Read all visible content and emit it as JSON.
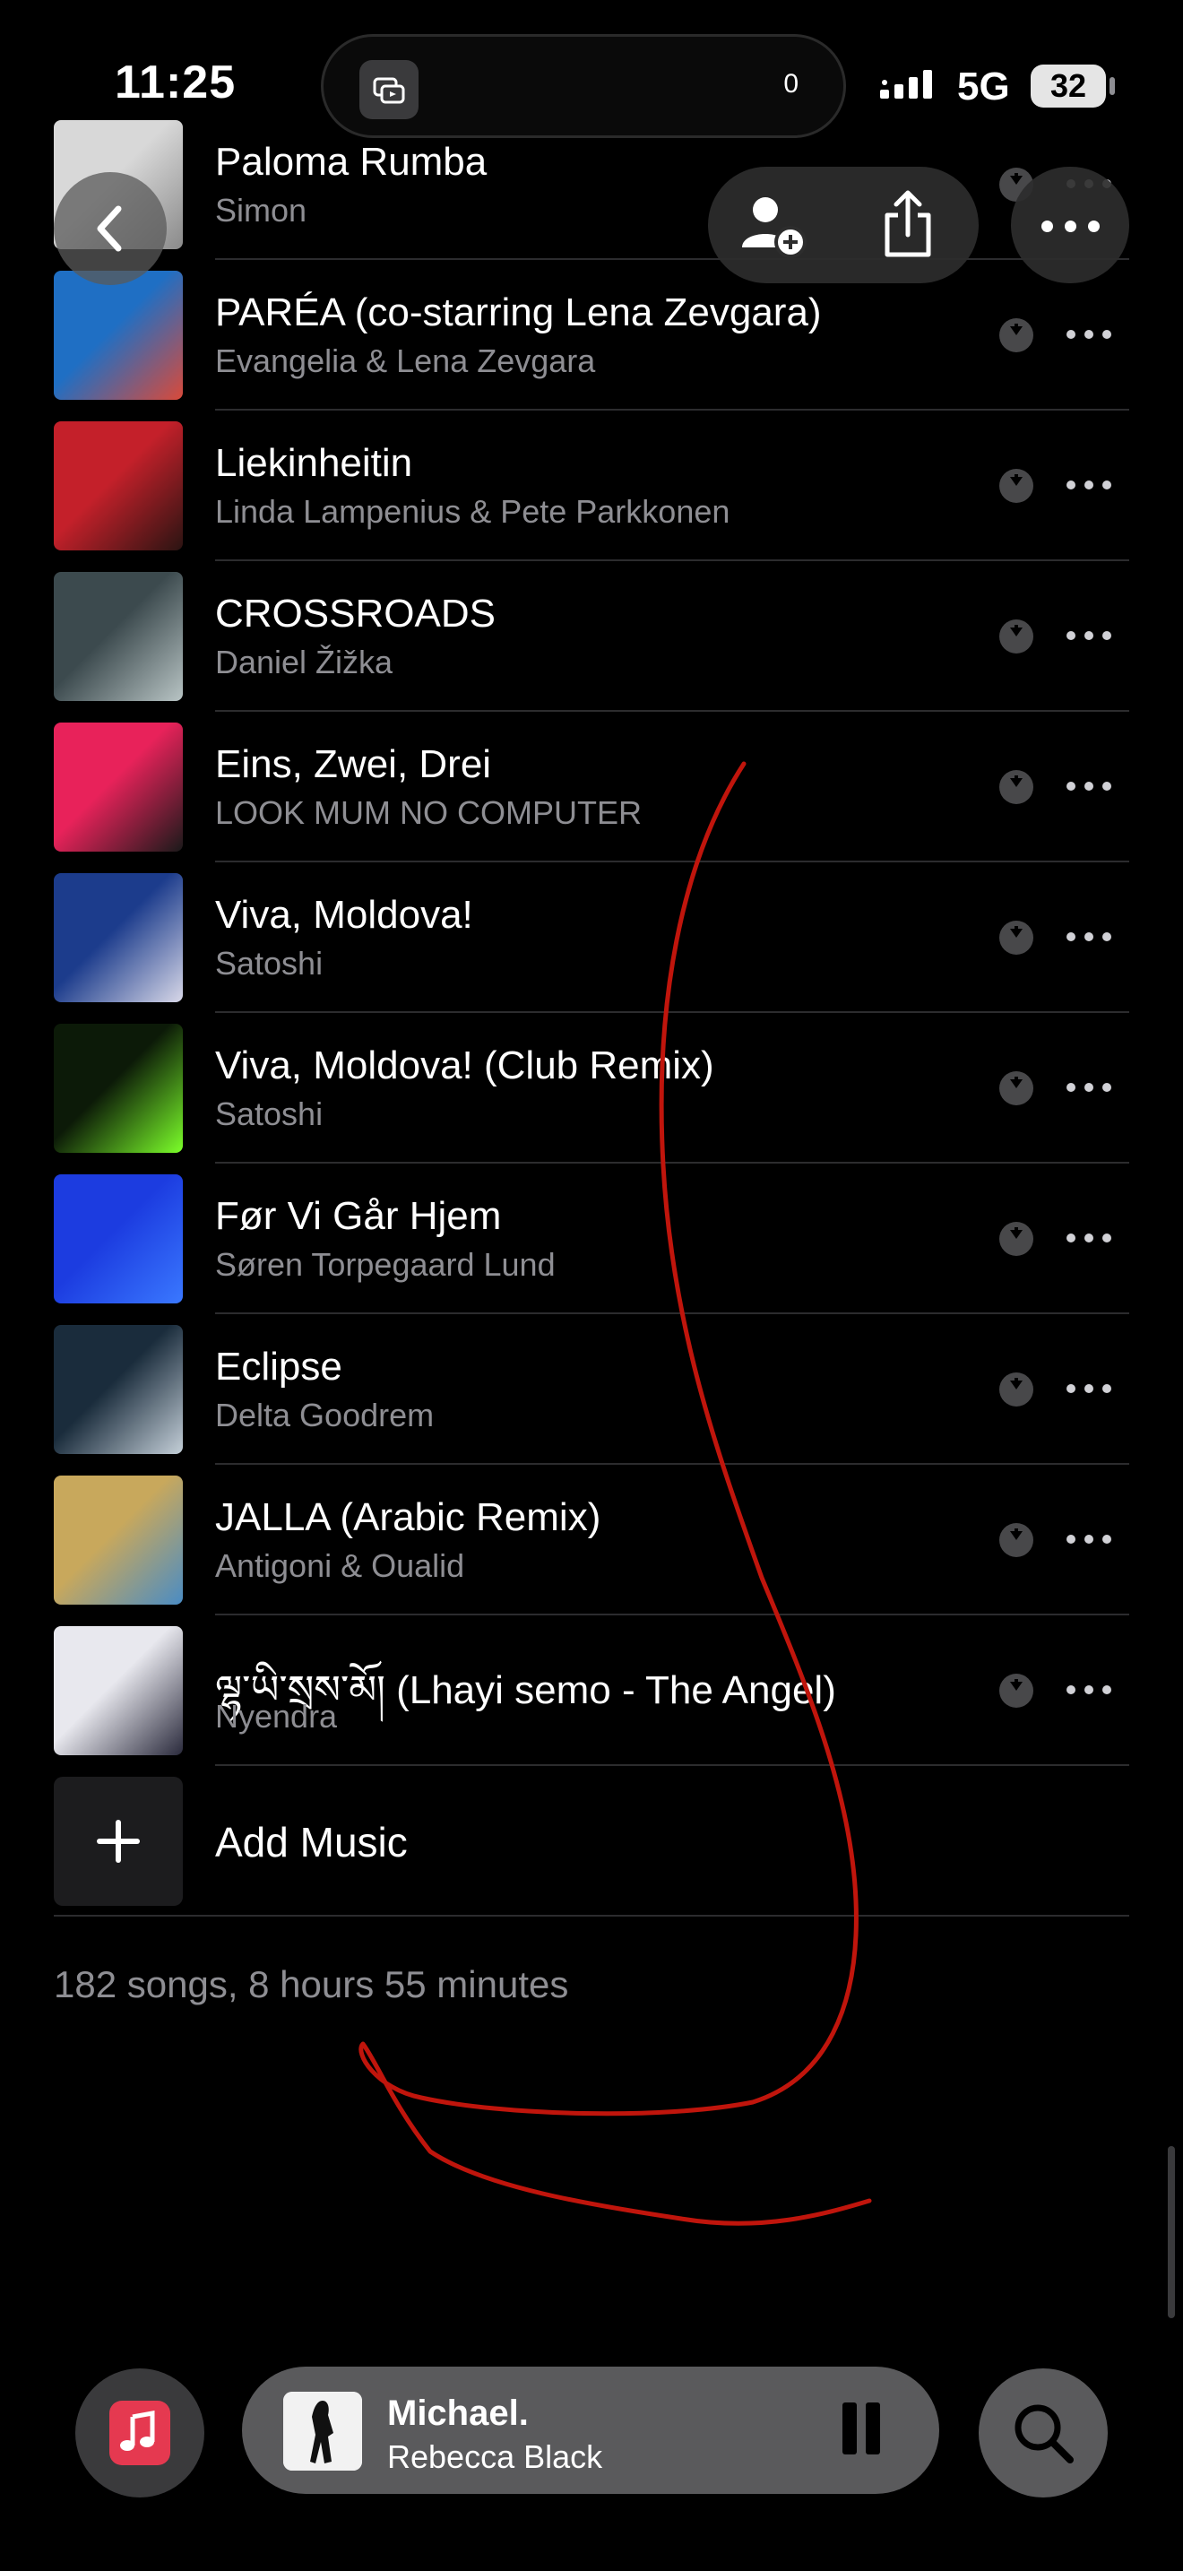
{
  "status_bar": {
    "time": "11:25",
    "island_count": "0",
    "network": "5G",
    "battery": "32"
  },
  "colors": {
    "background": "#000000",
    "secondary_text": "#8e8e93",
    "separator": "#2c2c2e",
    "music_app_red": "#e53950",
    "annotation_red": "#c0150c"
  },
  "icons": {
    "back": "chevron-left-icon",
    "add_user": "person-plus-icon",
    "share": "share-icon",
    "more": "ellipsis-icon",
    "download": "download-icon",
    "pause": "pause-icon",
    "search": "magnifier-icon",
    "music": "music-note-icon"
  },
  "songs": [
    {
      "title": "Paloma Rumba",
      "artist": "Simon",
      "art": [
        "#d8d8d8",
        "#8a8a8a"
      ]
    },
    {
      "title": "PARÉA (co-starring Lena Zevgara)",
      "artist": "Evangelia & Lena Zevgara",
      "art": [
        "#1f6fc4",
        "#d94a3a"
      ]
    },
    {
      "title": "Liekinheitin",
      "artist": "Linda Lampenius & Pete Parkkonen",
      "art": [
        "#c4202a",
        "#2a1412"
      ]
    },
    {
      "title": "CROSSROADS",
      "artist": "Daniel Žižka",
      "art": [
        "#3c4a4e",
        "#b8c4c4"
      ]
    },
    {
      "title": "Eins, Zwei, Drei",
      "artist": "LOOK MUM NO COMPUTER",
      "art": [
        "#e8225a",
        "#1a1a1a"
      ]
    },
    {
      "title": "Viva, Moldova!",
      "artist": "Satoshi",
      "art": [
        "#1c3c8c",
        "#d8d8e8"
      ]
    },
    {
      "title": "Viva, Moldova! (Club Remix)",
      "artist": "Satoshi",
      "art": [
        "#0c1a08",
        "#7cff2a"
      ]
    },
    {
      "title": "Før Vi Går Hjem",
      "artist": "Søren Torpegaard Lund",
      "art": [
        "#1c3ce0",
        "#3a78ff"
      ]
    },
    {
      "title": "Eclipse",
      "artist": "Delta Goodrem",
      "art": [
        "#1a2c3c",
        "#c4cfd8"
      ]
    },
    {
      "title": "JALLA (Arabic Remix)",
      "artist": "Antigoni & Oualid",
      "art": [
        "#c8a85c",
        "#4a8cc4"
      ]
    },
    {
      "title": "ལྷ་ཡི་སྲས་མོ། (Lhayi semo - The Angel)",
      "artist": "Nyendra",
      "art": [
        "#e8e8ee",
        "#2a2a3c"
      ]
    }
  ],
  "add_music": {
    "label": "Add Music"
  },
  "summary": "182 songs, 8 hours 55 minutes",
  "now_playing": {
    "song": "Michael.",
    "artist": "Rebecca Black"
  }
}
